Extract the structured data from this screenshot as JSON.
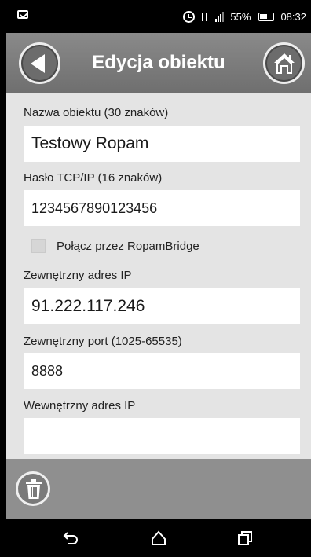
{
  "status_bar": {
    "battery": "55%",
    "time": "08:32",
    "icons": [
      "notification-icon",
      "alarm-icon",
      "data-icon",
      "signal-icon",
      "battery-icon"
    ]
  },
  "header": {
    "title": "Edycja obiektu",
    "back_icon": "back-arrow-icon",
    "home_icon": "home-icon"
  },
  "form": {
    "object_name": {
      "label": "Nazwa obiektu (30 znaków)",
      "value": "Testowy Ropam"
    },
    "tcp_password": {
      "label": "Hasło TCP/IP (16 znaków)",
      "value": "1234567890123456"
    },
    "bridge": {
      "label": "Połącz przez RopamBridge",
      "checked": false
    },
    "external_ip": {
      "label": "Zewnętrzny adres IP",
      "value": "91.222.117.246"
    },
    "external_port": {
      "label": "Zewnętrzny port (1025-65535)",
      "value": "8888"
    },
    "internal_ip": {
      "label": "Wewnętrzny adres IP",
      "value": ""
    }
  },
  "bottom_bar": {
    "delete_icon": "trash-icon"
  },
  "nav_bar": {
    "icons": [
      "back-nav-icon",
      "home-nav-icon",
      "recents-nav-icon"
    ]
  }
}
